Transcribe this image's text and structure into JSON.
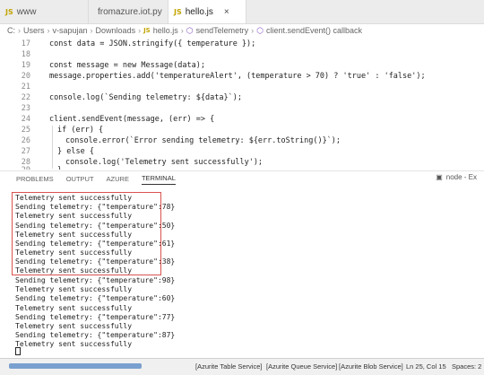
{
  "tabs": [
    {
      "icon": "JS",
      "label": "www",
      "active": false
    },
    {
      "icon": "python-icon",
      "label": "fromazure.iot.py",
      "active": false
    },
    {
      "icon": "JS",
      "label": "hello.js",
      "active": true,
      "close": "×"
    }
  ],
  "breadcrumb": [
    "C:",
    "Users",
    "v-sapujan",
    "Downloads",
    "hello.js",
    "sendTelemetry",
    "client.sendEvent() callback"
  ],
  "code_lines": [
    {
      "n": "17",
      "indent": "    ",
      "text": "const data = JSON.stringify({ temperature });"
    },
    {
      "n": "18",
      "indent": "",
      "text": ""
    },
    {
      "n": "19",
      "indent": "    ",
      "text": "const message = new Message(data);"
    },
    {
      "n": "20",
      "indent": "    ",
      "text": "message.properties.add('temperatureAlert', (temperature > 70) ? 'true' : 'false');"
    },
    {
      "n": "21",
      "indent": "",
      "text": ""
    },
    {
      "n": "22",
      "indent": "    ",
      "text": "console.log(`Sending telemetry: ${data}`);"
    },
    {
      "n": "23",
      "indent": "",
      "text": ""
    },
    {
      "n": "24",
      "indent": "    ",
      "text": "client.sendEvent(message, (err) => {"
    },
    {
      "n": "25",
      "indent": "      ",
      "text": "if (err) {"
    },
    {
      "n": "26",
      "indent": "        ",
      "text": "console.error(`Error sending telemetry: ${err.toString()}`);"
    },
    {
      "n": "27",
      "indent": "      ",
      "text": "} else {"
    },
    {
      "n": "28",
      "indent": "        ",
      "text": "console.log('Telemetry sent successfully');"
    },
    {
      "n": "29",
      "indent": "      ",
      "text": "}"
    }
  ],
  "panel": {
    "tabs": [
      "PROBLEMS",
      "OUTPUT",
      "AZURE",
      "TERMINAL"
    ],
    "active_tab": "TERMINAL",
    "terminal_name": "node - Ex"
  },
  "terminal_lines": [
    "Telemetry sent successfully",
    "Sending telemetry: {\"temperature\":78}",
    "Telemetry sent successfully",
    "Sending telemetry: {\"temperature\":50}",
    "Telemetry sent successfully",
    "Sending telemetry: {\"temperature\":61}",
    "Telemetry sent successfully",
    "Sending telemetry: {\"temperature\":38}",
    "Telemetry sent successfully",
    "Sending telemetry: {\"temperature\":98}",
    "Telemetry sent successfully",
    "Sending telemetry: {\"temperature\":60}",
    "Telemetry sent successfully",
    "Sending telemetry: {\"temperature\":77}",
    "Telemetry sent successfully",
    "Sending telemetry: {\"temperature\":87}",
    "Telemetry sent successfully"
  ],
  "status_bar": {
    "items": [
      "[Azurite Table Service]",
      "[Azurite Queue Service]",
      "[Azurite Blob Service]",
      "Ln 25, Col 15",
      "Spaces: 2"
    ]
  },
  "colors": {
    "keyword": "#0000ff",
    "string": "#a31515",
    "highlight_box": "#d9534f"
  }
}
